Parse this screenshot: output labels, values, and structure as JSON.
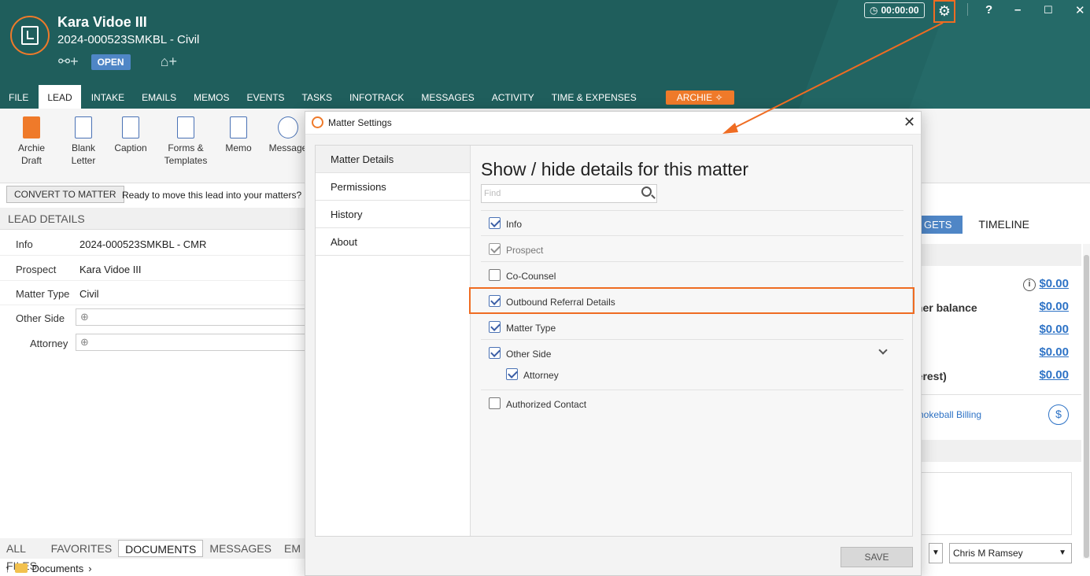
{
  "header": {
    "title": "Kara Vidoe III",
    "subtitle": "2024-000523SMKBL - Civil",
    "status_badge": "OPEN",
    "timer": "00:00:00",
    "help_label": "?",
    "icons": [
      "relationship-add-icon",
      "tag-add-icon",
      "clock-icon",
      "gear-icon",
      "minimize-icon",
      "maximize-icon",
      "close-icon"
    ]
  },
  "menu": {
    "tabs": [
      "FILE",
      "LEAD",
      "INTAKE",
      "EMAILS",
      "MEMOS",
      "EVENTS",
      "TASKS",
      "INFOTRACK",
      "MESSAGES",
      "ACTIVITY",
      "TIME & EXPENSES"
    ],
    "archie": "ARCHIE"
  },
  "ribbon": {
    "archie_draft": [
      "Archie",
      "Draft"
    ],
    "blank_letter": [
      "Blank",
      "Letter"
    ],
    "caption": "Caption",
    "forms_templates": [
      "Forms &",
      "Templates"
    ],
    "memo": "Memo",
    "message": "Message"
  },
  "convert": {
    "button": "CONVERT TO MATTER",
    "message": "Ready to move this lead into your matters?"
  },
  "lead_details": {
    "header": "LEAD DETAILS",
    "rows": [
      {
        "label": "Info",
        "value": "2024-000523SMKBL - CMR"
      },
      {
        "label": "Prospect",
        "value": "Kara Vidoe III"
      },
      {
        "label": "Matter Type",
        "value": "Civil"
      },
      {
        "label": "Other Side",
        "value": "⊕"
      },
      {
        "label": "Attorney",
        "value": "⊕"
      }
    ]
  },
  "bottom_tabs": [
    "ALL FILES",
    "FAVORITES",
    "DOCUMENTS",
    "MESSAGES",
    "EM"
  ],
  "path": "Documents",
  "right_pane": {
    "budgets_tab": "GETS",
    "timeline_tab": "TIMELINE",
    "rows": [
      {
        "label": "",
        "amount": "$0.00"
      },
      {
        "label": "iner balance",
        "amount": "$0.00"
      },
      {
        "label": "",
        "amount": "$0.00"
      },
      {
        "label": "",
        "amount": "$0.00"
      },
      {
        "label": "terest)",
        "amount": "$0.00"
      }
    ],
    "billing_link": "nokeball Billing",
    "dollar_icon": "$",
    "user_select": "Chris M Ramsey"
  },
  "modal": {
    "title": "Matter Settings",
    "nav": [
      "Matter Details",
      "Permissions",
      "History",
      "About"
    ],
    "heading": "Show / hide details for this matter",
    "find_placeholder": "Find",
    "items": [
      {
        "label": "Info",
        "checked": true,
        "disabled": false
      },
      {
        "label": "Prospect",
        "checked": true,
        "disabled": true
      },
      {
        "label": "Co-Counsel",
        "checked": false,
        "disabled": false
      },
      {
        "label": "Outbound Referral Details",
        "checked": true,
        "disabled": false
      },
      {
        "label": "Matter Type",
        "checked": true,
        "disabled": false
      },
      {
        "label": "Other Side",
        "checked": true,
        "disabled": false
      },
      {
        "label": "Attorney",
        "checked": true,
        "disabled": false
      },
      {
        "label": "Authorized Contact",
        "checked": false,
        "disabled": false
      }
    ],
    "save": "SAVE",
    "close": "✕"
  },
  "colors": {
    "header_bg": "#1f5e5c",
    "accent_orange": "#ef6c22",
    "link_blue": "#2e73c6",
    "badge_blue": "#4f86c6"
  }
}
